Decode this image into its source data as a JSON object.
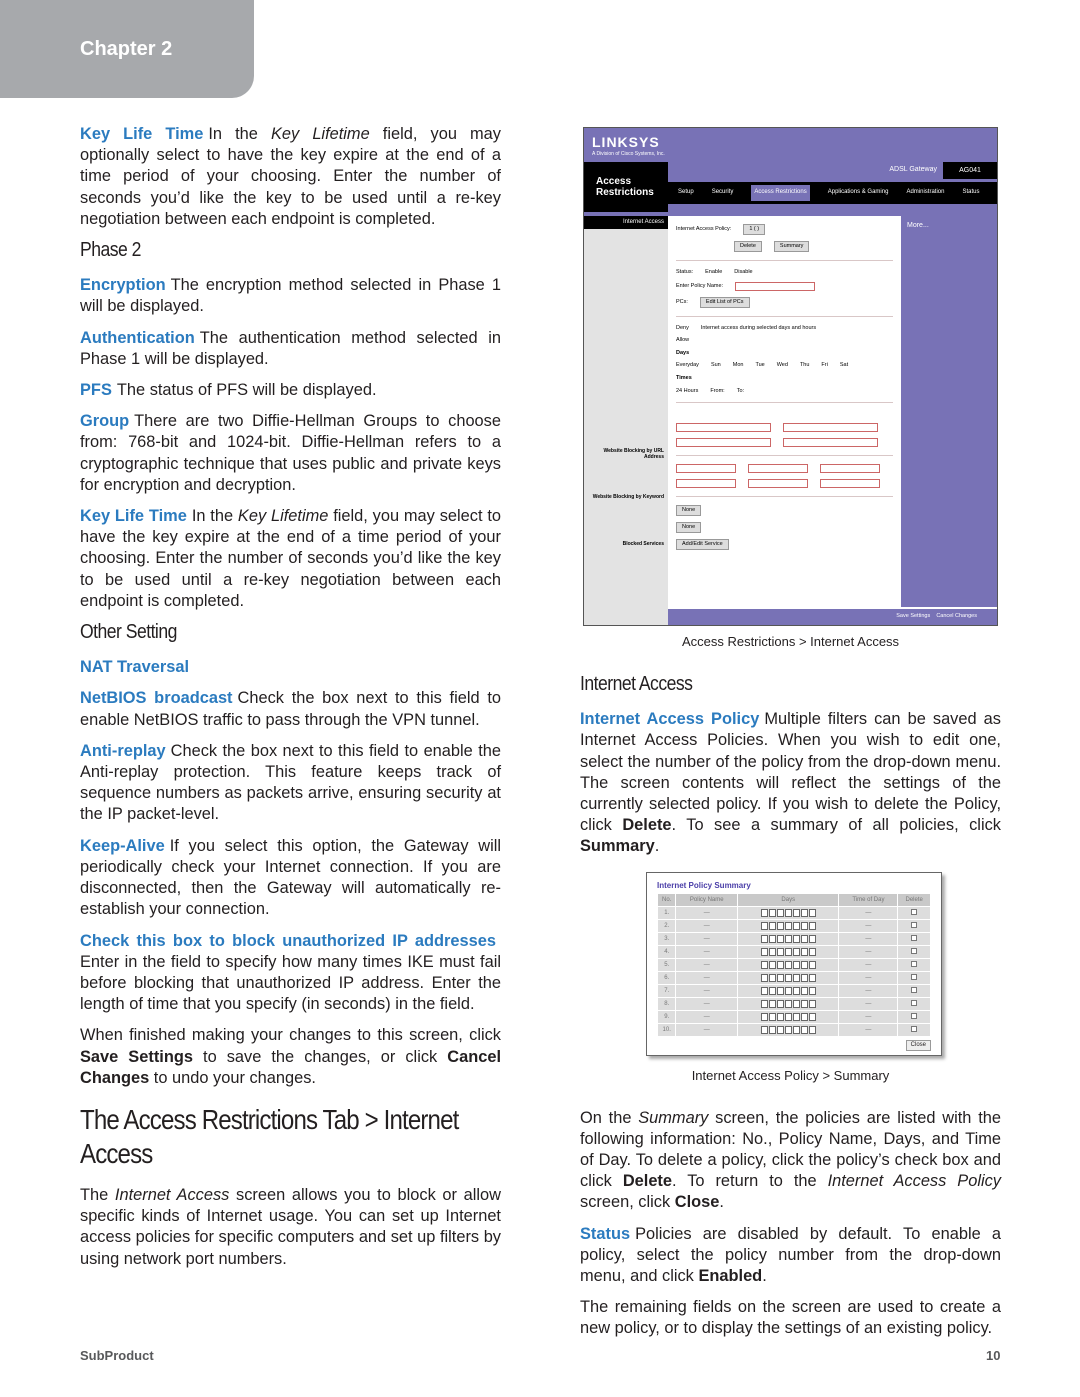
{
  "chapter": "Chapter 2",
  "left": [
    {
      "type": "p",
      "lead": "Key Life Time",
      "parts": [
        {
          "t": "In the "
        },
        {
          "t": "Key Lifetime",
          "i": 1
        },
        {
          "t": " field, you may optionally select to have the key expire at the end of a time period of your choosing. Enter the number of seconds you’d like the key to be used until a re-key negotiation between each endpoint is completed."
        }
      ]
    },
    {
      "type": "h2",
      "text": "Phase 2"
    },
    {
      "type": "p",
      "lead": "Encryption",
      "parts": [
        {
          "t": "The encryption method selected in Phase 1 will be displayed."
        }
      ]
    },
    {
      "type": "p",
      "lead": "Authentication",
      "parts": [
        {
          "t": "The authentication method selected in Phase 1 will be displayed."
        }
      ]
    },
    {
      "type": "p",
      "lead": "PFS",
      "parts": [
        {
          "t": "The status of PFS will be displayed."
        }
      ]
    },
    {
      "type": "p",
      "lead": "Group",
      "parts": [
        {
          "t": "There are two Diffie-Hellman Groups to choose from: 768-bit and 1024-bit. Diffie-Hellman refers to a cryptographic technique that uses public and private keys for encryption and decryption."
        }
      ]
    },
    {
      "type": "p",
      "lead": "Key Life Time",
      "parts": [
        {
          "t": "In the "
        },
        {
          "t": "Key Lifetime",
          "i": 1
        },
        {
          "t": " field, you may select to have the key expire at the end of a time period of your choosing. Enter the number of seconds you’d like the key to be used until a re-key negotiation between each endpoint is completed."
        }
      ]
    },
    {
      "type": "h2",
      "text": "Other Setting"
    },
    {
      "type": "p",
      "lead": "NAT Traversal",
      "parts": []
    },
    {
      "type": "p",
      "lead": "NetBIOS broadcast",
      "parts": [
        {
          "t": "Check the box next to this field to enable NetBIOS traffic to pass through the VPN tunnel."
        }
      ]
    },
    {
      "type": "p",
      "lead": "Anti-replay",
      "parts": [
        {
          "t": "Check the box next to this field to enable the Anti-replay protection. This feature keeps track of sequence numbers as packets arrive, ensuring security at the IP packet-level."
        }
      ]
    },
    {
      "type": "p",
      "lead": "Keep-Alive",
      "parts": [
        {
          "t": "If you select this option, the Gateway will periodically check your Internet connection. If you are disconnected, then the Gateway will automatically re-establish your connection."
        }
      ]
    },
    {
      "type": "p",
      "lead": "Check this box to block unauthorized IP addresses",
      "parts": [
        {
          "t": " Enter in the field to specify how many times IKE must fail before blocking that unauthorized IP address. Enter the length of time that you specify (in seconds) in the field."
        }
      ]
    },
    {
      "type": "p",
      "parts": [
        {
          "t": "When finished making your changes to this screen, click "
        },
        {
          "t": "Save Settings",
          "b": 1
        },
        {
          "t": " to save the changes, or click "
        },
        {
          "t": "Cancel Changes",
          "b": 1
        },
        {
          "t": " to undo your changes."
        }
      ]
    },
    {
      "type": "h1",
      "text": "The Access Restrictions Tab > Internet Access"
    },
    {
      "type": "p",
      "parts": [
        {
          "t": "The "
        },
        {
          "t": "Internet Access",
          "i": 1
        },
        {
          "t": " screen allows you to block or allow specific kinds of Internet usage. You can set up Internet access policies for specific computers and set up filters by using network port numbers."
        }
      ]
    }
  ],
  "figure1": {
    "caption": "Access Restrictions > Internet Access",
    "logo": "LINKSYS",
    "logo_sub": "A Division of Cisco Systems, Inc.",
    "section": "Access Restrictions",
    "product": "ADSL Gateway",
    "model": "AG041",
    "tabs": [
      "Setup",
      "Security",
      "Access Restrictions",
      "Applications & Gaming",
      "Administration",
      "Status"
    ],
    "sidebar": "Internet Access",
    "more": "More...",
    "policy_label": "Internet Access Policy:",
    "policy_value": "1 ( )",
    "delete": "Delete",
    "summary": "Summary",
    "status_label": "Status:",
    "enable": "Enable",
    "disable": "Disable",
    "name_label": "Enter Policy Name:",
    "pcs_label": "PCs:",
    "edit_pcs": "Edit List of PCs",
    "deny": "Deny",
    "allow": "Allow",
    "access_text": "Internet access during selected days and hours",
    "days_label": "Days",
    "everyday": "Everyday",
    "days": [
      "Sun",
      "Mon",
      "Tue",
      "Wed",
      "Thu",
      "Fri",
      "Sat"
    ],
    "times_label": "Times",
    "hours24": "24 Hours",
    "from": "From:",
    "to": "To:",
    "url_label": "Website Blocking by URL Address",
    "kw_label": "Website Blocking by Keyword",
    "svc_label": "Blocked Services",
    "none": "None",
    "add_svc": "Add/Edit Service",
    "save": "Save Settings",
    "cancel": "Cancel Changes"
  },
  "right": [
    {
      "type": "h2",
      "text": "Internet Access"
    },
    {
      "type": "p",
      "lead": "Internet Access Policy",
      "parts": [
        {
          "t": "Multiple filters can be saved as Internet Access Policies. When you wish to edit one, select the number of the policy from the drop-down menu. The screen contents will reflect the settings of the currently selected policy. If you wish to delete the Policy, click "
        },
        {
          "t": "Delete",
          "b": 1
        },
        {
          "t": ". To see a summary of all policies, click "
        },
        {
          "t": "Summary",
          "b": 1
        },
        {
          "t": "."
        }
      ]
    }
  ],
  "figure2": {
    "caption": "Internet Access Policy > Summary",
    "title": "Internet Policy Summary",
    "headers": [
      "No.",
      "Policy Name",
      "Days",
      "Time of Day",
      "Delete"
    ],
    "rows": [
      "1.",
      "2.",
      "3.",
      "4.",
      "5.",
      "6.",
      "7.",
      "8.",
      "9.",
      "10."
    ],
    "dash": "—",
    "day_letters": [
      "S",
      "M",
      "T",
      "W",
      "T",
      "F",
      "S"
    ],
    "close": "Close"
  },
  "right2": [
    {
      "type": "p",
      "parts": [
        {
          "t": "On the "
        },
        {
          "t": "Summary",
          "i": 1
        },
        {
          "t": " screen, the policies are listed with the following information: No., Policy Name, Days, and Time of Day. To delete a policy, click the policy’s check box and click "
        },
        {
          "t": "Delete",
          "b": 1
        },
        {
          "t": ". To return to the "
        },
        {
          "t": "Internet Access Policy",
          "i": 1
        },
        {
          "t": " screen, click "
        },
        {
          "t": "Close",
          "b": 1
        },
        {
          "t": "."
        }
      ]
    },
    {
      "type": "p",
      "lead": "Status",
      "parts": [
        {
          "t": "Policies are disabled by default. To enable a policy, select the policy number from the drop-down menu, and click "
        },
        {
          "t": "Enabled",
          "b": 1
        },
        {
          "t": "."
        }
      ]
    },
    {
      "type": "p",
      "parts": [
        {
          "t": "The remaining fields on the screen are used to create a new policy, or to display the settings of an existing policy."
        }
      ]
    }
  ],
  "footer": {
    "left": "SubProduct",
    "page": "10"
  },
  "colors": {
    "accent": "#2b7bbf",
    "chapter_tab": "#a7a9ac",
    "linksys_purple": "#7872b6"
  }
}
